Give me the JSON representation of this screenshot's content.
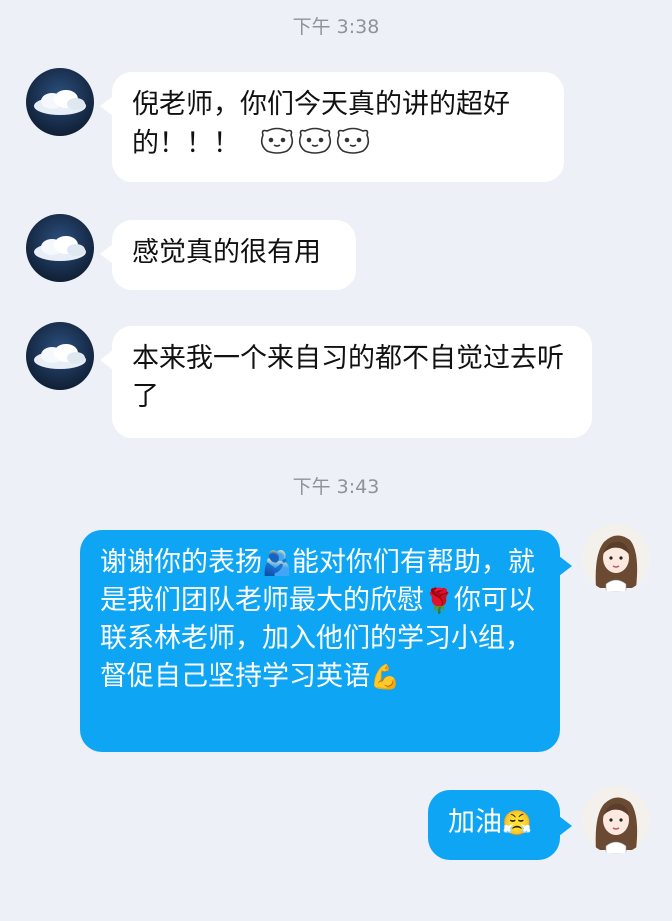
{
  "chat": {
    "timestamps": [
      "下午 3:38",
      "下午 3:43"
    ],
    "messages": [
      {
        "sender": "other",
        "text": "倪老师，你们今天真的讲的超好的！！！",
        "trailing_icons": [
          "bear-face-icon",
          "bear-face-icon",
          "bear-face-icon"
        ]
      },
      {
        "sender": "other",
        "text": "感觉真的很有用"
      },
      {
        "sender": "other",
        "text": "本来我一个来自习的都不自觉过去听了"
      },
      {
        "sender": "me",
        "parts": [
          "谢谢你的表扬",
          "能对你们有帮助，就是我们团队老师最大的欣慰",
          "你可以联系林老师，加入他们的学习小组，督促自己坚持学习英语"
        ],
        "icons": [
          "person-hug-icon",
          "rose-icon",
          "flexed-biceps-icon"
        ]
      },
      {
        "sender": "me",
        "text": "加油",
        "icons": [
          "determined-face-headband-icon"
        ]
      }
    ]
  },
  "colors": {
    "background": "#edf0f7",
    "incoming_bubble": "#ffffff",
    "outgoing_bubble": "#0ea6f4",
    "timestamp": "#8d929c"
  }
}
